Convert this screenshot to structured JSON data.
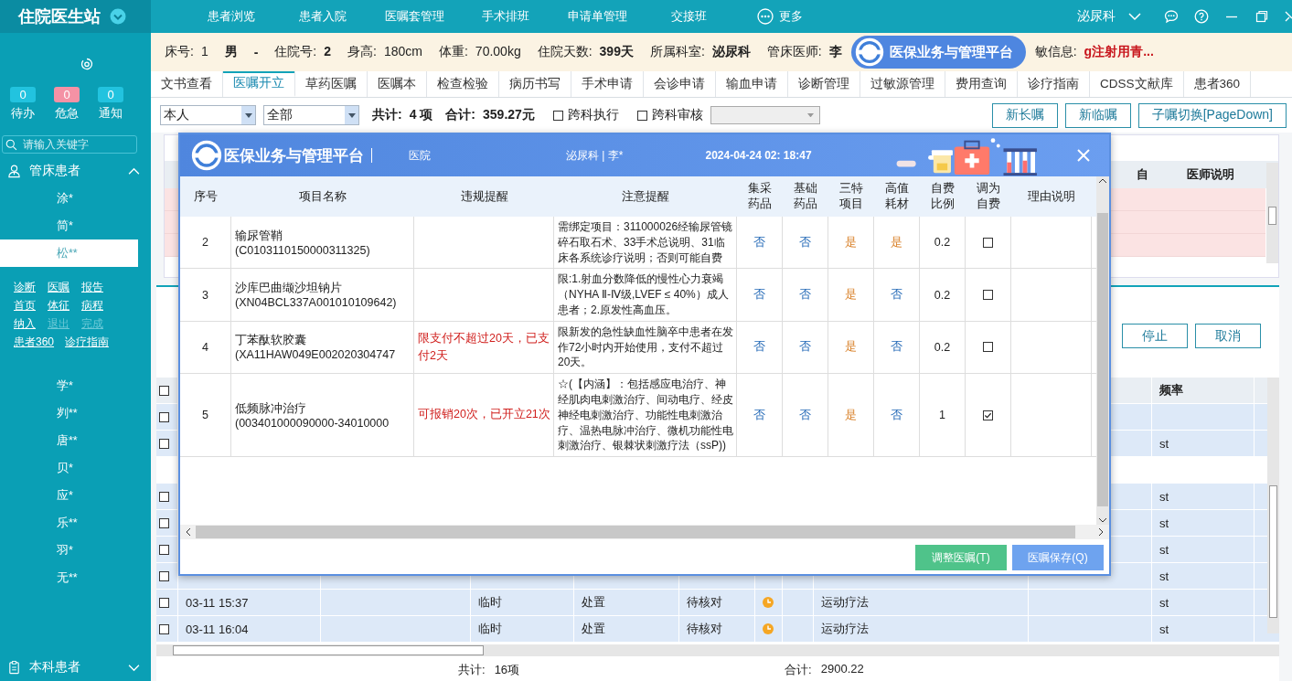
{
  "app": {
    "title": "住院医生站"
  },
  "nav": [
    {
      "label": "患者浏览",
      "kind": "plain"
    },
    {
      "label": "患者入院",
      "kind": "plain"
    },
    {
      "label": "医嘱套管理",
      "kind": "plain"
    },
    {
      "label": "手术排班",
      "kind": "plain"
    },
    {
      "label": "申请单管理",
      "kind": "plain"
    },
    {
      "label": "交接班",
      "kind": "plain"
    },
    {
      "label": "更多",
      "kind": "more"
    }
  ],
  "department_menu": {
    "label": "泌尿科"
  },
  "sidebar": {
    "counters": [
      {
        "count": "0",
        "label": "待办",
        "color": "#22c3df"
      },
      {
        "count": "0",
        "label": "危急",
        "color": "#f492a5"
      },
      {
        "count": "0",
        "label": "通知",
        "color": "#22c3df"
      }
    ],
    "search": {
      "placeholder": "请输入关键字"
    },
    "groups": [
      {
        "title": "管床患者",
        "expanded": true,
        "patients": [
          {
            "name": "涂*",
            "selected": false
          },
          {
            "name": "简*",
            "selected": false
          },
          {
            "name": "松**",
            "selected": true,
            "action_rows": [
              [
                {
                  "label": "诊断",
                  "disabled": false
                },
                {
                  "label": "医嘱",
                  "disabled": false
                },
                {
                  "label": "报告",
                  "disabled": false
                }
              ],
              [
                {
                  "label": "首页",
                  "disabled": false
                },
                {
                  "label": "体征",
                  "disabled": false
                },
                {
                  "label": "病程",
                  "disabled": false
                }
              ],
              [
                {
                  "label": "纳入",
                  "disabled": false
                },
                {
                  "label": "退出",
                  "disabled": true
                },
                {
                  "label": "完成",
                  "disabled": true
                }
              ],
              [
                {
                  "label": "患者360",
                  "disabled": false
                },
                {
                  "label": "诊疗指南",
                  "disabled": false
                }
              ]
            ]
          },
          {
            "name": "学*",
            "selected": false
          },
          {
            "name": "刿**",
            "selected": false
          },
          {
            "name": "唐**",
            "selected": false
          },
          {
            "name": "贝*",
            "selected": false
          },
          {
            "name": "应*",
            "selected": false
          },
          {
            "name": "乐**",
            "selected": false
          },
          {
            "name": "羽*",
            "selected": false
          },
          {
            "name": "无**",
            "selected": false
          }
        ]
      },
      {
        "title": "本科患者",
        "expanded": false
      }
    ]
  },
  "patient": {
    "fields": [
      {
        "label": "床号:",
        "value": "1",
        "kind": "normal"
      },
      {
        "value": "男",
        "kind": "bold"
      },
      {
        "value": "-",
        "kind": "bold"
      },
      {
        "label": "住院号:",
        "value": "2",
        "kind": "bold"
      },
      {
        "label": "身高:",
        "value": "180cm",
        "kind": "normal"
      },
      {
        "label": "体重:",
        "value": "70.00kg",
        "kind": "normal"
      },
      {
        "label": "住院天数:",
        "value": "399天",
        "kind": "bold"
      },
      {
        "label": "所属科室:",
        "value": "泌尿科",
        "kind": "bold"
      },
      {
        "label": "管床医师:",
        "value": "李",
        "kind": "bold"
      }
    ],
    "allergy": {
      "label": "敏信息:",
      "value": "g注射用青...",
      "kind": "alert"
    }
  },
  "platform_badge": {
    "title": "医保业务与管理平台"
  },
  "tabs": [
    {
      "label": "文书查看",
      "selected": false
    },
    {
      "label": "医嘱开立",
      "selected": true
    },
    {
      "label": "草药医嘱",
      "selected": false
    },
    {
      "label": "医嘱本",
      "selected": false
    },
    {
      "label": "检查检验",
      "selected": false
    },
    {
      "label": "病历书写",
      "selected": false
    },
    {
      "label": "手术申请",
      "selected": false
    },
    {
      "label": "会诊申请",
      "selected": false
    },
    {
      "label": "输血申请",
      "selected": false
    },
    {
      "label": "诊断管理",
      "selected": false
    },
    {
      "label": "过敏源管理",
      "selected": false
    },
    {
      "label": "费用查询",
      "selected": false
    },
    {
      "label": "诊疗指南",
      "selected": false
    },
    {
      "label": "CDSS文献库",
      "selected": false
    },
    {
      "label": "患者360",
      "selected": false
    }
  ],
  "toolbar": {
    "filters": [
      {
        "value": "本人"
      },
      {
        "value": "全部"
      }
    ],
    "count_label": "共计:",
    "count": "4 项",
    "sum_label": "合计:",
    "sum": "359.27元",
    "checks": [
      {
        "label": "跨科执行",
        "checked": false
      },
      {
        "label": "跨科审核",
        "checked": false
      }
    ],
    "extra_select": {
      "disabled": true
    },
    "buttons": [
      "新长嘱",
      "新临嘱",
      "子嘱切换[PageDown]"
    ]
  },
  "upper_table": {
    "columns": [
      "自",
      "医师说明"
    ],
    "rows": [
      {
        "kind": "alert"
      },
      {
        "kind": "alert"
      },
      {
        "kind": "alert"
      }
    ]
  },
  "lower_panel": {
    "buttons": [
      "停止",
      "取消"
    ],
    "header_checkbox": {
      "checked": false
    },
    "columns": [
      "频率"
    ],
    "rows": [
      {
        "kind": "item",
        "checked": false
      },
      {
        "kind": "item",
        "checked": false,
        "frequency": "st"
      },
      {
        "kind": "blank"
      },
      {
        "kind": "item",
        "checked": false,
        "frequency": "st"
      },
      {
        "kind": "item",
        "checked": false,
        "frequency": "st"
      },
      {
        "kind": "item",
        "checked": false,
        "frequency": "st"
      },
      {
        "kind": "item",
        "checked": false,
        "frequency": "st"
      },
      {
        "kind": "item",
        "checked": false,
        "time": "03-11 15:37",
        "type": "临时",
        "category": "处置",
        "status": "待核对",
        "pending": true,
        "name": "运动疗法",
        "frequency": "st"
      },
      {
        "kind": "item",
        "checked": false,
        "time": "03-11 16:04",
        "type": "临时",
        "category": "处置",
        "status": "待核对",
        "pending": true,
        "name": "运动疗法",
        "frequency": "st"
      }
    ],
    "footer": {
      "count_label": "共计:",
      "count": "16项",
      "sum_label": "合计:",
      "sum": "2900.22"
    }
  },
  "dialog": {
    "title": "医保业务与管理平台",
    "org": "医院",
    "dept_doctor": "泌尿科 | 李*",
    "datetime": "2024-04-24 02: 18:47",
    "columns": [
      "序号",
      "项目名称",
      "违规提醒",
      "注意提醒",
      "集采药品",
      "基础药品",
      "三特项目",
      "高值耗材",
      "自费比例",
      "调为自费",
      "理由说明"
    ],
    "rows": [
      {
        "no": "2",
        "name": "输尿管鞘",
        "code": "(C0103110150000311325)",
        "note": "需绑定项目：311000026经输尿管镜碎石取石术、33手术总说明、31临床各系统诊疗说明；否则可能自费",
        "flags": [
          {
            "text": "否",
            "highlight": false
          },
          {
            "text": "否",
            "highlight": false
          },
          {
            "text": "是",
            "highlight": true
          },
          {
            "text": "是",
            "highlight": true
          }
        ],
        "ratio": "0.2",
        "self_pay": false
      },
      {
        "no": "3",
        "name": "沙库巴曲缬沙坦钠片",
        "code": "(XN04BCL337A001010109642)",
        "note": "限:1.射血分数降低的慢性心力衰竭（NYHA Ⅱ-Ⅳ级,LVEF ≤ 40%）成人患者；2.原发性高血压。",
        "flags": [
          {
            "text": "否",
            "highlight": false
          },
          {
            "text": "否",
            "highlight": false
          },
          {
            "text": "是",
            "highlight": true
          },
          {
            "text": "否",
            "highlight": false
          }
        ],
        "ratio": "0.2",
        "self_pay": false
      },
      {
        "no": "4",
        "name": "丁苯酞软胶囊",
        "code": "(XA11HAW049E002020304747",
        "violation": "限支付不超过20天，已支付2天",
        "note": "限新发的急性缺血性脑卒中患者在发作72小时内开始使用，支付不超过20天。",
        "flags": [
          {
            "text": "否",
            "highlight": false
          },
          {
            "text": "否",
            "highlight": false
          },
          {
            "text": "是",
            "highlight": true
          },
          {
            "text": "否",
            "highlight": false
          }
        ],
        "ratio": "0.2",
        "self_pay": false
      },
      {
        "no": "5",
        "name": "低频脉冲治疗",
        "code": "(003401000090000-34010000",
        "violation": "可报销20次，已开立21次",
        "note": "☆(【内涵】：包括感应电治疗、神经肌肉电刺激治疗、间动电疗、经皮神经电刺激治疗、功能性电刺激治疗、温热电脉冲治疗、微机功能性电刺激治疗、银棘状刺激疗法（ssP))",
        "flags": [
          {
            "text": "否",
            "highlight": false
          },
          {
            "text": "否",
            "highlight": false
          },
          {
            "text": "是",
            "highlight": true
          },
          {
            "text": "否",
            "highlight": false
          }
        ],
        "ratio": "1",
        "self_pay": true
      }
    ],
    "buttons": [
      {
        "label": "调整医嘱(T)",
        "kind": "secondary"
      },
      {
        "label": "医嘱保存(Q)",
        "kind": "primary"
      }
    ]
  }
}
